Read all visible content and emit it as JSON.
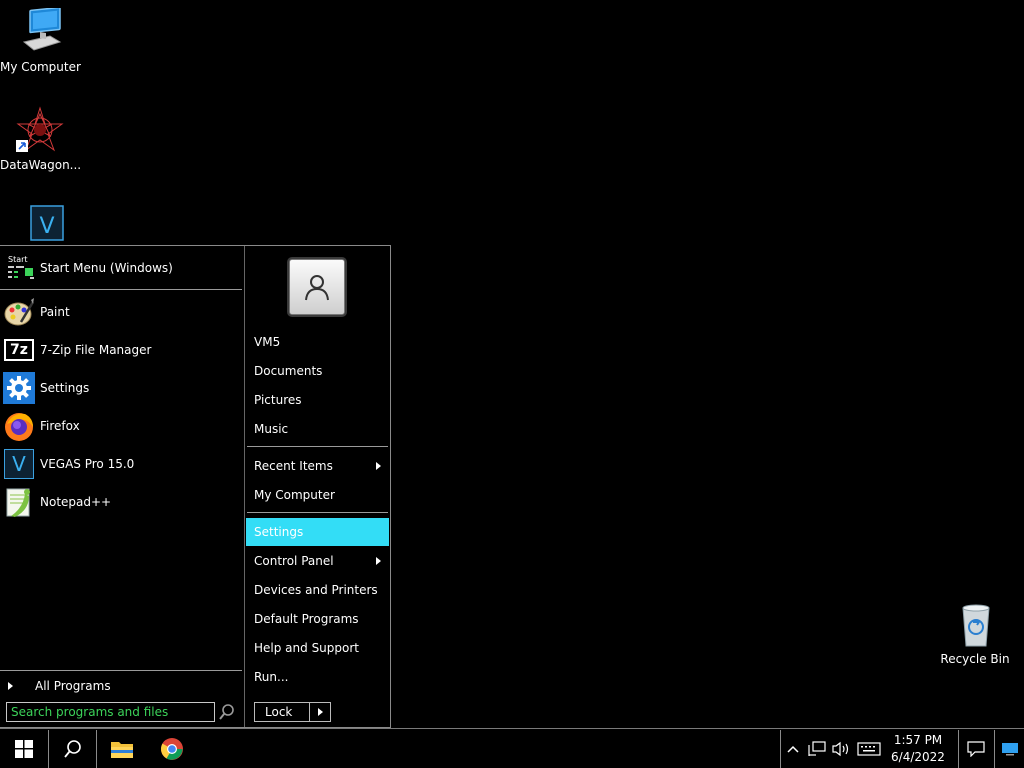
{
  "desktop": {
    "icons": [
      {
        "label": "My Computer",
        "icon": "computer-icon"
      },
      {
        "label": "DataWagon...",
        "icon": "datawagon-icon"
      },
      {
        "label": "",
        "icon": "vegas-icon"
      },
      {
        "label": "Recycle Bin",
        "icon": "recycle-bin-icon"
      }
    ]
  },
  "start_menu": {
    "header": {
      "label": "Start Menu (Windows)",
      "icon_text": "Start"
    },
    "programs": [
      {
        "label": "Paint",
        "icon": "paint-icon"
      },
      {
        "label": "7-Zip File Manager",
        "icon": "7zip-icon",
        "icon_text": "7z"
      },
      {
        "label": "Settings",
        "icon": "settings-gear-icon"
      },
      {
        "label": "Firefox",
        "icon": "firefox-icon"
      },
      {
        "label": "VEGAS Pro 15.0",
        "icon": "vegas-icon",
        "icon_text": "V"
      },
      {
        "label": "Notepad++",
        "icon": "notepadpp-icon"
      }
    ],
    "all_programs": "All Programs",
    "search_placeholder": "Search programs and files",
    "right": {
      "user": "VM5",
      "items_top": [
        "Documents",
        "Pictures",
        "Music"
      ],
      "items_mid": [
        "Recent Items",
        "My Computer"
      ],
      "items_bottom": [
        "Settings",
        "Control Panel",
        "Devices and Printers",
        "Default Programs",
        "Help and Support",
        "Run..."
      ],
      "active_item": "Settings"
    },
    "lock_label": "Lock"
  },
  "taskbar": {
    "time": "1:57 PM",
    "date": "6/4/2022",
    "accent": "#33ddf6"
  }
}
